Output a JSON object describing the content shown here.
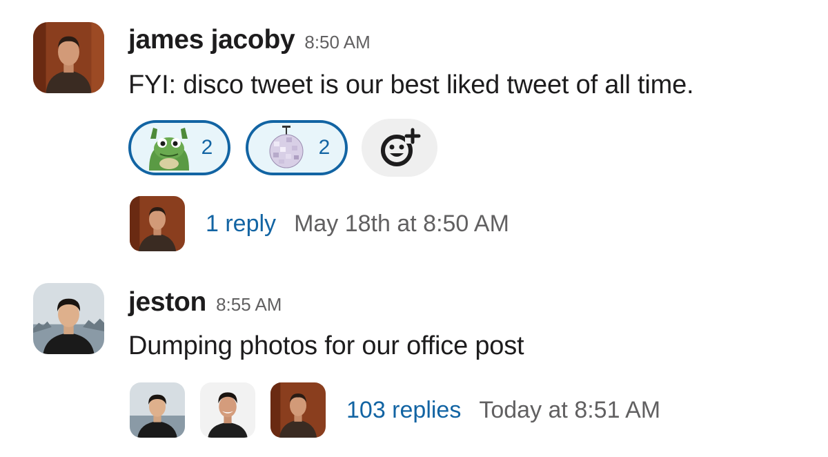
{
  "messages": [
    {
      "author": "james jacoby",
      "time": "8:50 AM",
      "text": "FYI: disco tweet is our best liked tweet of all time.",
      "avatar_icon": "person-photo-icon",
      "reactions": [
        {
          "emoji": "frog-icon",
          "count": "2"
        },
        {
          "emoji": "disco-ball-icon",
          "count": "2"
        }
      ],
      "add_reaction_icon": "add-reaction-icon",
      "thread": {
        "reply_count": "1 reply",
        "last_reply": "May 18th at 8:50 AM"
      }
    },
    {
      "author": "jeston",
      "time": "8:55 AM",
      "text": "Dumping photos for our office post",
      "avatar_icon": "person-photo-icon",
      "thread": {
        "reply_count": "103 replies",
        "last_reply": "Today at 8:51 AM"
      }
    }
  ],
  "colors": {
    "link": "#1264a3",
    "reaction_bg": "#e8f5fa",
    "muted": "#616061",
    "text": "#1d1c1d"
  }
}
